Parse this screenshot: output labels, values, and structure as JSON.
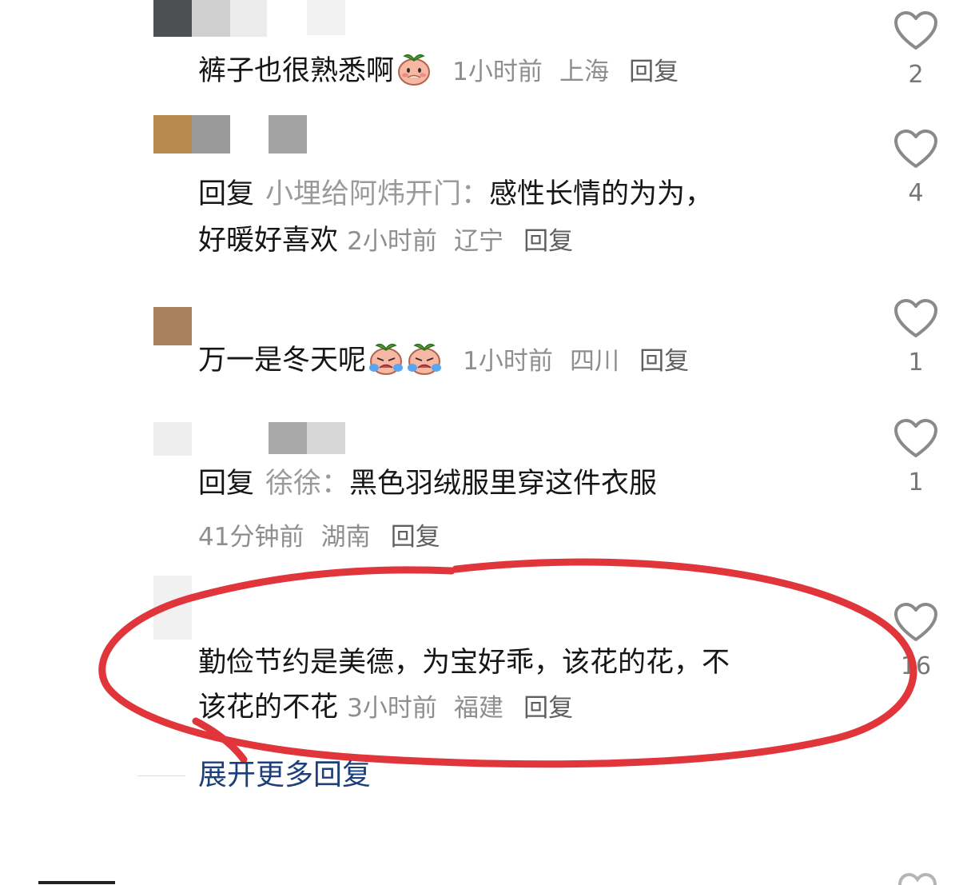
{
  "comments": [
    {
      "text": "裤子也很熟悉啊",
      "time": "1小时前",
      "location": "上海",
      "reply_label": "回复",
      "likes": "2",
      "emoji": [
        "shy-peach-emoji"
      ]
    },
    {
      "reply_prefix": "回复",
      "quoted_user": "小埋给阿炜开门：",
      "text_line1": "感性长情的为为，",
      "text_line2": "好暖好喜欢",
      "time": "2小时前",
      "location": "辽宁",
      "reply_label": "回复",
      "likes": "4"
    },
    {
      "text": "万一是冬天呢",
      "time": "1小时前",
      "location": "四川",
      "reply_label": "回复",
      "likes": "1",
      "emoji": [
        "crying-peach-emoji",
        "crying-peach-emoji"
      ]
    },
    {
      "reply_prefix": "回复",
      "quoted_user": "徐徐：",
      "text": "黑色羽绒服里穿这件衣服",
      "time": "41分钟前",
      "location": "湖南",
      "reply_label": "回复",
      "likes": "1"
    },
    {
      "text_line1": "勤俭节约是美德，为宝好乖，该花的花，不",
      "text_line2": "该花的不花",
      "time": "3小时前",
      "location": "福建",
      "reply_label": "回复",
      "likes": "16",
      "highlighted": true
    }
  ],
  "expand_label": "展开更多回复",
  "icons": {
    "like": "heart-outline-icon"
  },
  "colors": {
    "text": "#161616",
    "meta": "#8e8e8e",
    "expand_link": "#1d3f7a",
    "annotation_circle": "#e0363b",
    "heart_stroke": "#8a8a8a"
  }
}
